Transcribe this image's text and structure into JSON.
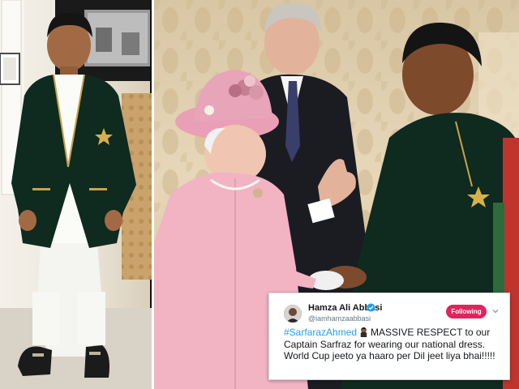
{
  "tweet": {
    "author_name": "Hamza Ali Abbasi",
    "author_handle": "@iamhamzaabbasi",
    "follow_label": "Following",
    "hashtag": "#SarfarazAhmed",
    "text_after_emoji": "MASSIVE RESPECT to our Captain Sarfraz for wearing our national dress.  World Cup jeeto ya haaro per Dil jeet liya bhai!!!!!"
  },
  "icons": {
    "verified": "verified-badge-icon",
    "caret": "chevron-down-icon",
    "emoji": "man-emoji-icon"
  },
  "colors": {
    "follow_button": "#e0245e",
    "hashtag": "#1da1f2",
    "verified": "#1da1f2"
  }
}
